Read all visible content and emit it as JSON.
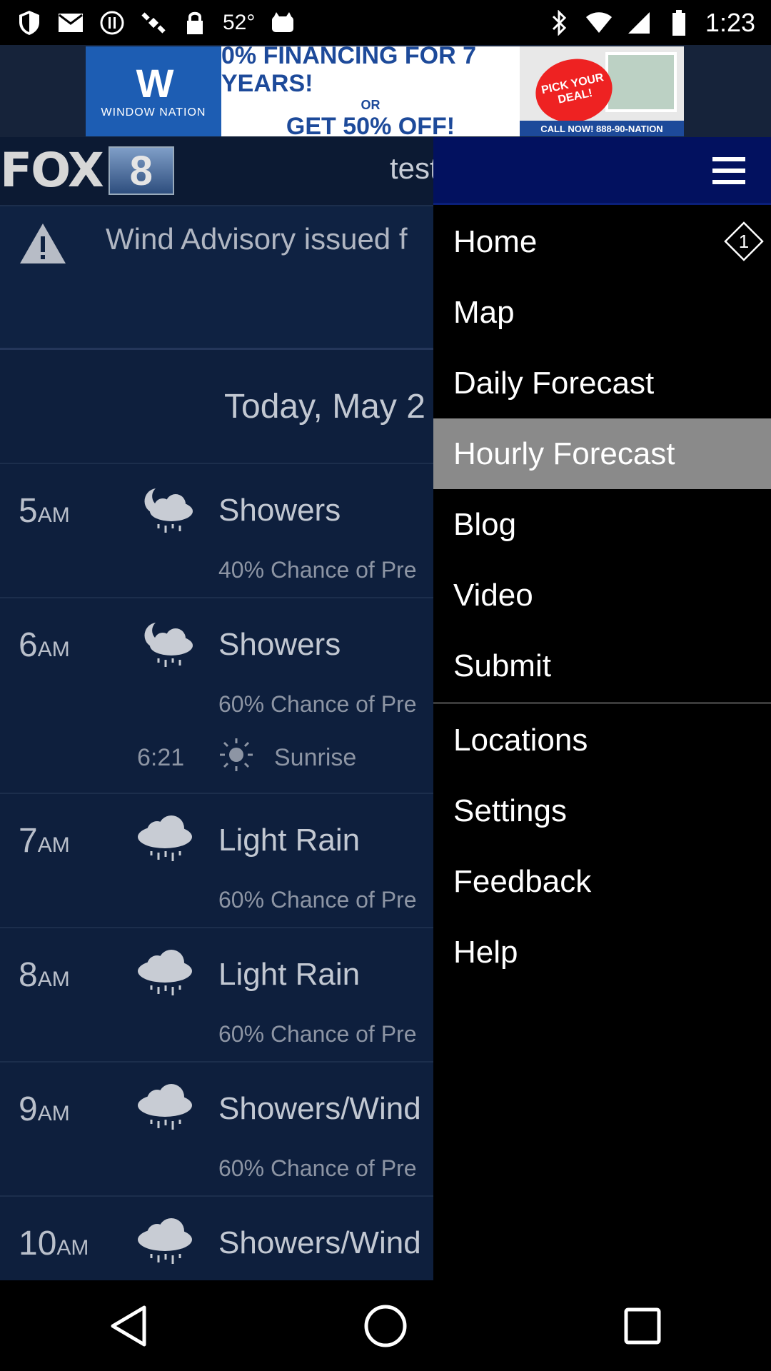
{
  "status_bar": {
    "temperature": "52°",
    "time": "1:23"
  },
  "ad": {
    "brand": "WINDOW NATION",
    "line1": "0% FINANCING FOR 7 YEARS!",
    "or": "OR",
    "line2": "GET 50% OFF!",
    "badge": "PICK YOUR DEAL!",
    "call": "CALL NOW! 888-90-NATION"
  },
  "header": {
    "logo_text": "FOX",
    "logo_channel": "8",
    "location": "test"
  },
  "advisory": {
    "text": "Wind Advisory issued f"
  },
  "date_label": "Today, May 2",
  "hours": [
    {
      "hour": "5",
      "ampm": "AM",
      "condition": "Showers",
      "precip": "40% Chance of Pre",
      "icon": "night-showers-icon"
    },
    {
      "hour": "6",
      "ampm": "AM",
      "condition": "Showers",
      "precip": "60% Chance of Pre",
      "icon": "night-showers-icon",
      "sunrise_time": "6:21",
      "sunrise_label": "Sunrise"
    },
    {
      "hour": "7",
      "ampm": "AM",
      "condition": "Light Rain",
      "precip": "60% Chance of Pre",
      "icon": "rain-cloud-icon"
    },
    {
      "hour": "8",
      "ampm": "AM",
      "condition": "Light Rain",
      "precip": "60% Chance of Pre",
      "icon": "rain-cloud-icon"
    },
    {
      "hour": "9",
      "ampm": "AM",
      "condition": "Showers/Wind",
      "precip": "60% Chance of Pre",
      "icon": "rain-cloud-icon"
    },
    {
      "hour": "10",
      "ampm": "AM",
      "condition": "Showers/Wind",
      "precip": "",
      "icon": "rain-cloud-icon"
    }
  ],
  "drawer": {
    "items": [
      {
        "label": "Home",
        "badge": "1"
      },
      {
        "label": "Map"
      },
      {
        "label": "Daily Forecast"
      },
      {
        "label": "Hourly Forecast",
        "active": true
      },
      {
        "label": "Blog"
      },
      {
        "label": "Video"
      },
      {
        "label": "Submit"
      }
    ],
    "secondary_items": [
      {
        "label": "Locations"
      },
      {
        "label": "Settings"
      },
      {
        "label": "Feedback"
      },
      {
        "label": "Help"
      }
    ]
  },
  "colors": {
    "drawer_header": "#02115f",
    "content_bg": "#0e1f3d",
    "active_item": "#8a8a8a"
  }
}
